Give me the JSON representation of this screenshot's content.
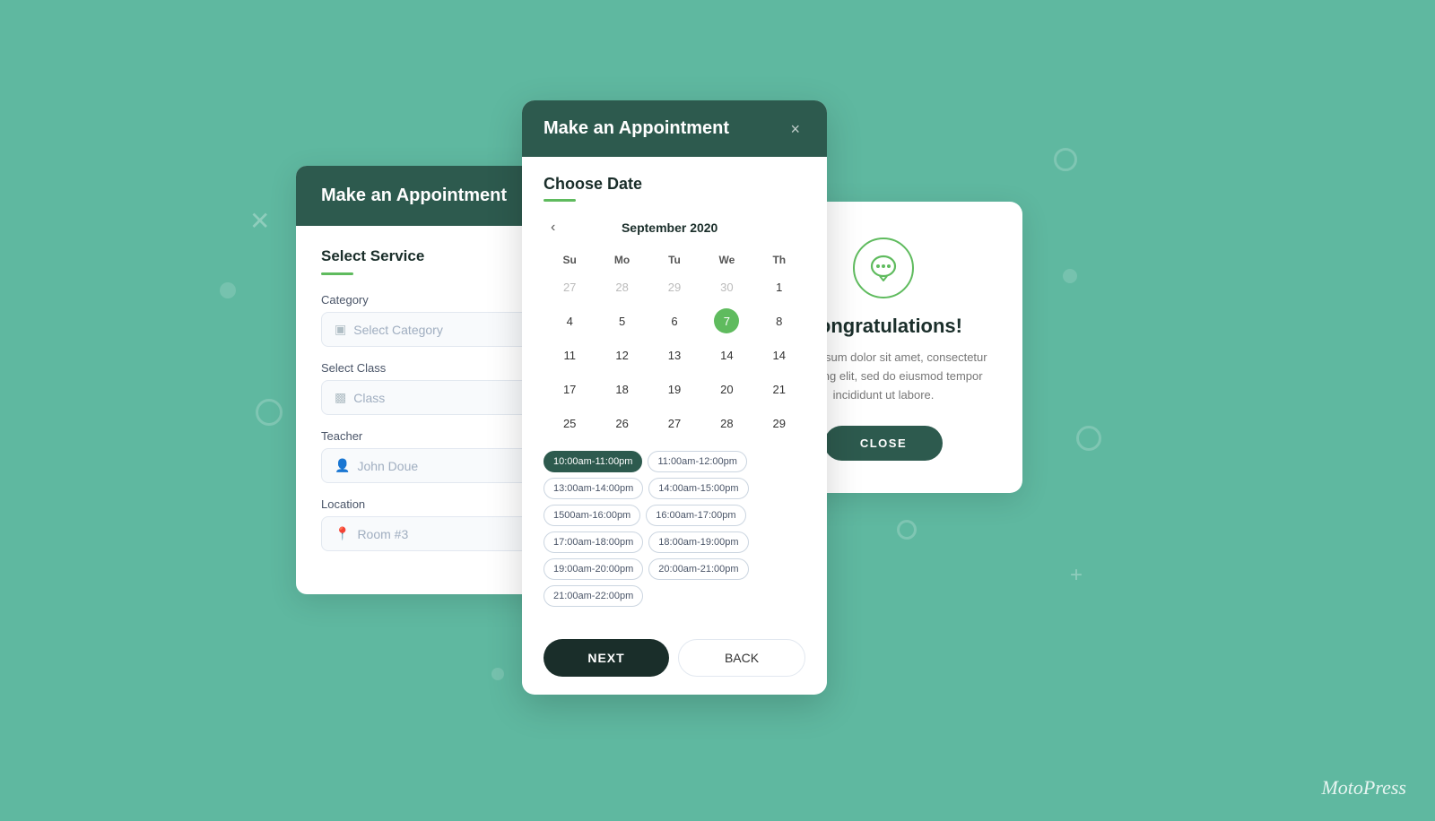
{
  "background": {
    "color": "#5fb8a0"
  },
  "card1": {
    "header": "Make an Appointment",
    "section_title": "Select Service",
    "category_label": "Category",
    "category_placeholder": "Select Category",
    "class_label": "Select Class",
    "class_placeholder": "Class",
    "teacher_label": "Teacher",
    "teacher_placeholder": "John Doue",
    "location_label": "Location",
    "location_placeholder": "Room #3"
  },
  "card2": {
    "header": "Make an Appointment",
    "close_btn": "×",
    "choose_date_title": "Choose Date",
    "calendar": {
      "month": "September 2020",
      "days_of_week": [
        "Su",
        "Mo",
        "Tu",
        "We",
        "Th"
      ],
      "weeks": [
        [
          {
            "day": 27,
            "prev": true
          },
          {
            "day": 28,
            "prev": true
          },
          {
            "day": 29,
            "prev": true
          },
          {
            "day": 30,
            "prev": true
          },
          {
            "day": 1,
            "prev": false
          }
        ],
        [
          {
            "day": 4
          },
          {
            "day": 5
          },
          {
            "day": 6
          },
          {
            "day": 7,
            "selected": true
          },
          {
            "day": 8
          }
        ],
        [
          {
            "day": 11
          },
          {
            "day": 12
          },
          {
            "day": 13
          },
          {
            "day": 14
          },
          {
            "day": 14
          }
        ],
        [
          {
            "day": 17
          },
          {
            "day": 18
          },
          {
            "day": 19
          },
          {
            "day": 20
          },
          {
            "day": 21
          }
        ],
        [
          {
            "day": 25
          },
          {
            "day": 26
          },
          {
            "day": 27
          },
          {
            "day": 28
          },
          {
            "day": 29
          }
        ]
      ]
    },
    "time_slots": [
      {
        "label": "10:00am-11:00pm",
        "active": true
      },
      {
        "label": "11:00am-12:00pm",
        "active": false
      },
      {
        "label": "13:00am-14:00pm",
        "active": false
      },
      {
        "label": "14:00am-15:00pm",
        "active": false
      },
      {
        "label": "1500am-16:00pm",
        "active": false
      },
      {
        "label": "16:00am-17:00pm",
        "active": false
      },
      {
        "label": "17:00am-18:00pm",
        "active": false
      },
      {
        "label": "18:00am-19:00pm",
        "active": false
      },
      {
        "label": "19:00am-20:00pm",
        "active": false
      },
      {
        "label": "20:00am-21:00pm",
        "active": false
      },
      {
        "label": "21:00am-22:00pm",
        "active": false
      }
    ],
    "btn_next": "NEXT",
    "btn_back": "BACK"
  },
  "card3": {
    "icon_label": "chat-bubble",
    "title": "Congratulations!",
    "text": "Lorem ipsum dolor sit amet, consectetur adipiscing elit, sed do eiusmod tempor incididunt ut labore.",
    "btn_close": "CLOSE"
  },
  "watermark": "MotoPress"
}
